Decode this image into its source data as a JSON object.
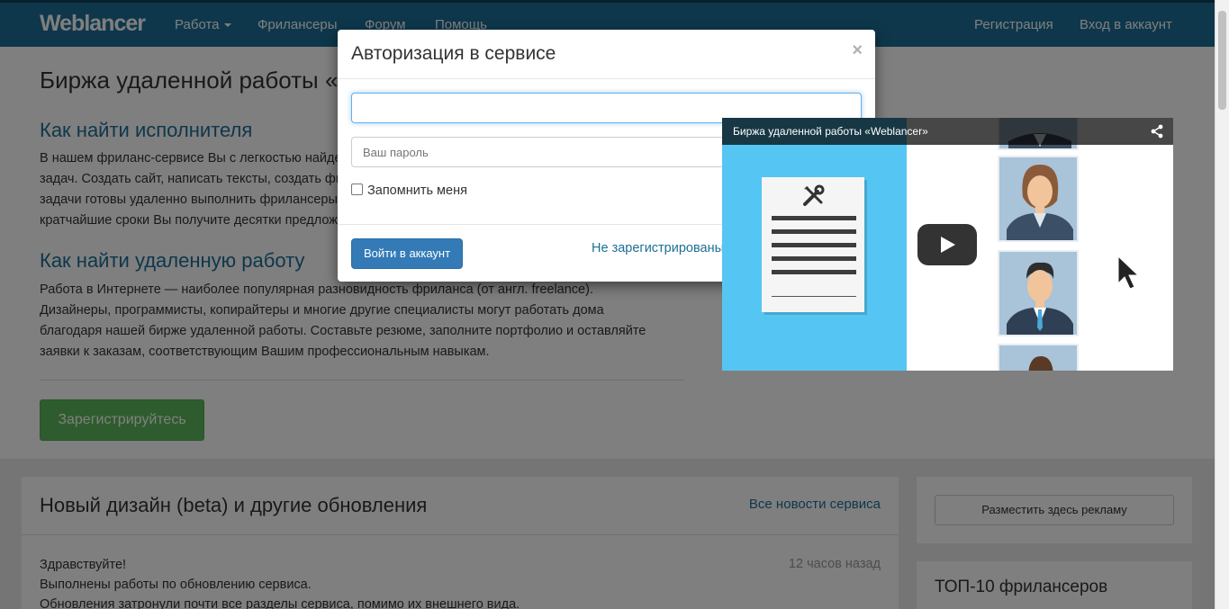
{
  "navbar": {
    "logo": "Weblancer",
    "items": [
      {
        "label": "Работа"
      },
      {
        "label": "Фрилансеры"
      },
      {
        "label": "Форум"
      },
      {
        "label": "Помощь"
      }
    ],
    "register": "Регистрация",
    "login": "Вход в аккаунт"
  },
  "hero": {
    "title": "Биржа удаленной работы «Weblancer»",
    "section1": {
      "heading": "Как найти исполнителя",
      "lines": [
        "В нашем фриланс-сервисе Вы с легкостью найдете исполнителя для решения любых",
        "задач. Создать сайт, написать тексты, создать фирменный стиль или решить другие",
        "задачи готовы удаленно выполнить фрилансеры. Разместите заказ на проект, и в",
        "кратчайшие сроки Вы получите десятки предложений от исполнителей."
      ]
    },
    "section2": {
      "heading": "Как найти удаленную работу",
      "lines": [
        "Работа в Интернете — наиболее популярная разновидность фриланса (от англ. freelance).",
        "Дизайнеры, программисты, копирайтеры и многие другие специалисты могут работать дома",
        "благодаря нашей бирже удаленной работы. Составьте резюме, заполните портфолио и оставляйте",
        "заявки к заказам, соответствующим Вашим профессиональным навыкам."
      ]
    },
    "register_button": "Зарегистрируйтесь"
  },
  "news": {
    "title": "Новый дизайн (beta) и другие обновления",
    "all_link": "Все новости сервиса",
    "time": "12 часов назад",
    "lines": [
      "Здравствуйте!",
      "Выполнены работы по обновлению сервиса.",
      "Обновления затронули почти все разделы сервиса, помимо их внешнего вида."
    ]
  },
  "sidebar": {
    "ad_button": "Разместить здесь рекламу",
    "top_title": "ТОП-10 фрилансеров"
  },
  "modal": {
    "title": "Авторизация в сервисе",
    "close": "×",
    "login_value": "",
    "password_placeholder": "Ваш пароль",
    "remember": "Запомнить меня",
    "submit": "Войти в аккаунт",
    "not_registered": "Не зарегистрированы?"
  },
  "video": {
    "title": "Биржа удаленной работы «Weblancer»",
    "icons": {
      "share": "share-icon",
      "play": "play-icon",
      "tools": "tools-icon",
      "cursor": "cursor-icon"
    }
  },
  "colors": {
    "navbar": "#1c6f96",
    "link": "#1c6f96",
    "green_button": "#5cb85c",
    "blue_button": "#337ab7",
    "video_blue": "#55c6f3"
  }
}
